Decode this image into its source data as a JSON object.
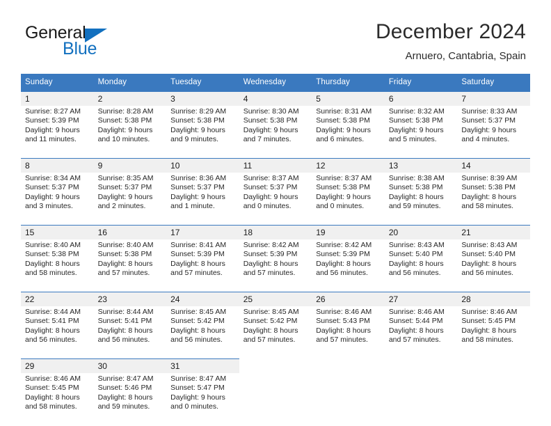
{
  "logo": {
    "word_one": "General",
    "word_two": "Blue",
    "triangle_icon": "blue-triangle-icon",
    "brand_color": "#1270bf"
  },
  "header": {
    "title": "December 2024",
    "subtitle": "Arnuero, Cantabria, Spain"
  },
  "calendar": {
    "header_bg": "#3a79bf",
    "daynum_bg": "#f0f0f0",
    "weekday_headers": [
      "Sunday",
      "Monday",
      "Tuesday",
      "Wednesday",
      "Thursday",
      "Friday",
      "Saturday"
    ],
    "weeks": [
      {
        "days": [
          {
            "date": "1",
            "sunrise": "Sunrise: 8:27 AM",
            "sunset": "Sunset: 5:39 PM",
            "daylight_line1": "Daylight: 9 hours",
            "daylight_line2": "and 11 minutes."
          },
          {
            "date": "2",
            "sunrise": "Sunrise: 8:28 AM",
            "sunset": "Sunset: 5:38 PM",
            "daylight_line1": "Daylight: 9 hours",
            "daylight_line2": "and 10 minutes."
          },
          {
            "date": "3",
            "sunrise": "Sunrise: 8:29 AM",
            "sunset": "Sunset: 5:38 PM",
            "daylight_line1": "Daylight: 9 hours",
            "daylight_line2": "and 9 minutes."
          },
          {
            "date": "4",
            "sunrise": "Sunrise: 8:30 AM",
            "sunset": "Sunset: 5:38 PM",
            "daylight_line1": "Daylight: 9 hours",
            "daylight_line2": "and 7 minutes."
          },
          {
            "date": "5",
            "sunrise": "Sunrise: 8:31 AM",
            "sunset": "Sunset: 5:38 PM",
            "daylight_line1": "Daylight: 9 hours",
            "daylight_line2": "and 6 minutes."
          },
          {
            "date": "6",
            "sunrise": "Sunrise: 8:32 AM",
            "sunset": "Sunset: 5:38 PM",
            "daylight_line1": "Daylight: 9 hours",
            "daylight_line2": "and 5 minutes."
          },
          {
            "date": "7",
            "sunrise": "Sunrise: 8:33 AM",
            "sunset": "Sunset: 5:37 PM",
            "daylight_line1": "Daylight: 9 hours",
            "daylight_line2": "and 4 minutes."
          }
        ]
      },
      {
        "days": [
          {
            "date": "8",
            "sunrise": "Sunrise: 8:34 AM",
            "sunset": "Sunset: 5:37 PM",
            "daylight_line1": "Daylight: 9 hours",
            "daylight_line2": "and 3 minutes."
          },
          {
            "date": "9",
            "sunrise": "Sunrise: 8:35 AM",
            "sunset": "Sunset: 5:37 PM",
            "daylight_line1": "Daylight: 9 hours",
            "daylight_line2": "and 2 minutes."
          },
          {
            "date": "10",
            "sunrise": "Sunrise: 8:36 AM",
            "sunset": "Sunset: 5:37 PM",
            "daylight_line1": "Daylight: 9 hours",
            "daylight_line2": "and 1 minute."
          },
          {
            "date": "11",
            "sunrise": "Sunrise: 8:37 AM",
            "sunset": "Sunset: 5:37 PM",
            "daylight_line1": "Daylight: 9 hours",
            "daylight_line2": "and 0 minutes."
          },
          {
            "date": "12",
            "sunrise": "Sunrise: 8:37 AM",
            "sunset": "Sunset: 5:38 PM",
            "daylight_line1": "Daylight: 9 hours",
            "daylight_line2": "and 0 minutes."
          },
          {
            "date": "13",
            "sunrise": "Sunrise: 8:38 AM",
            "sunset": "Sunset: 5:38 PM",
            "daylight_line1": "Daylight: 8 hours",
            "daylight_line2": "and 59 minutes."
          },
          {
            "date": "14",
            "sunrise": "Sunrise: 8:39 AM",
            "sunset": "Sunset: 5:38 PM",
            "daylight_line1": "Daylight: 8 hours",
            "daylight_line2": "and 58 minutes."
          }
        ]
      },
      {
        "days": [
          {
            "date": "15",
            "sunrise": "Sunrise: 8:40 AM",
            "sunset": "Sunset: 5:38 PM",
            "daylight_line1": "Daylight: 8 hours",
            "daylight_line2": "and 58 minutes."
          },
          {
            "date": "16",
            "sunrise": "Sunrise: 8:40 AM",
            "sunset": "Sunset: 5:38 PM",
            "daylight_line1": "Daylight: 8 hours",
            "daylight_line2": "and 57 minutes."
          },
          {
            "date": "17",
            "sunrise": "Sunrise: 8:41 AM",
            "sunset": "Sunset: 5:39 PM",
            "daylight_line1": "Daylight: 8 hours",
            "daylight_line2": "and 57 minutes."
          },
          {
            "date": "18",
            "sunrise": "Sunrise: 8:42 AM",
            "sunset": "Sunset: 5:39 PM",
            "daylight_line1": "Daylight: 8 hours",
            "daylight_line2": "and 57 minutes."
          },
          {
            "date": "19",
            "sunrise": "Sunrise: 8:42 AM",
            "sunset": "Sunset: 5:39 PM",
            "daylight_line1": "Daylight: 8 hours",
            "daylight_line2": "and 56 minutes."
          },
          {
            "date": "20",
            "sunrise": "Sunrise: 8:43 AM",
            "sunset": "Sunset: 5:40 PM",
            "daylight_line1": "Daylight: 8 hours",
            "daylight_line2": "and 56 minutes."
          },
          {
            "date": "21",
            "sunrise": "Sunrise: 8:43 AM",
            "sunset": "Sunset: 5:40 PM",
            "daylight_line1": "Daylight: 8 hours",
            "daylight_line2": "and 56 minutes."
          }
        ]
      },
      {
        "days": [
          {
            "date": "22",
            "sunrise": "Sunrise: 8:44 AM",
            "sunset": "Sunset: 5:41 PM",
            "daylight_line1": "Daylight: 8 hours",
            "daylight_line2": "and 56 minutes."
          },
          {
            "date": "23",
            "sunrise": "Sunrise: 8:44 AM",
            "sunset": "Sunset: 5:41 PM",
            "daylight_line1": "Daylight: 8 hours",
            "daylight_line2": "and 56 minutes."
          },
          {
            "date": "24",
            "sunrise": "Sunrise: 8:45 AM",
            "sunset": "Sunset: 5:42 PM",
            "daylight_line1": "Daylight: 8 hours",
            "daylight_line2": "and 56 minutes."
          },
          {
            "date": "25",
            "sunrise": "Sunrise: 8:45 AM",
            "sunset": "Sunset: 5:42 PM",
            "daylight_line1": "Daylight: 8 hours",
            "daylight_line2": "and 57 minutes."
          },
          {
            "date": "26",
            "sunrise": "Sunrise: 8:46 AM",
            "sunset": "Sunset: 5:43 PM",
            "daylight_line1": "Daylight: 8 hours",
            "daylight_line2": "and 57 minutes."
          },
          {
            "date": "27",
            "sunrise": "Sunrise: 8:46 AM",
            "sunset": "Sunset: 5:44 PM",
            "daylight_line1": "Daylight: 8 hours",
            "daylight_line2": "and 57 minutes."
          },
          {
            "date": "28",
            "sunrise": "Sunrise: 8:46 AM",
            "sunset": "Sunset: 5:45 PM",
            "daylight_line1": "Daylight: 8 hours",
            "daylight_line2": "and 58 minutes."
          }
        ]
      },
      {
        "days": [
          {
            "date": "29",
            "sunrise": "Sunrise: 8:46 AM",
            "sunset": "Sunset: 5:45 PM",
            "daylight_line1": "Daylight: 8 hours",
            "daylight_line2": "and 58 minutes."
          },
          {
            "date": "30",
            "sunrise": "Sunrise: 8:47 AM",
            "sunset": "Sunset: 5:46 PM",
            "daylight_line1": "Daylight: 8 hours",
            "daylight_line2": "and 59 minutes."
          },
          {
            "date": "31",
            "sunrise": "Sunrise: 8:47 AM",
            "sunset": "Sunset: 5:47 PM",
            "daylight_line1": "Daylight: 9 hours",
            "daylight_line2": "and 0 minutes."
          },
          {
            "date": "",
            "sunrise": "",
            "sunset": "",
            "daylight_line1": "",
            "daylight_line2": ""
          },
          {
            "date": "",
            "sunrise": "",
            "sunset": "",
            "daylight_line1": "",
            "daylight_line2": ""
          },
          {
            "date": "",
            "sunrise": "",
            "sunset": "",
            "daylight_line1": "",
            "daylight_line2": ""
          },
          {
            "date": "",
            "sunrise": "",
            "sunset": "",
            "daylight_line1": "",
            "daylight_line2": ""
          }
        ]
      }
    ]
  }
}
